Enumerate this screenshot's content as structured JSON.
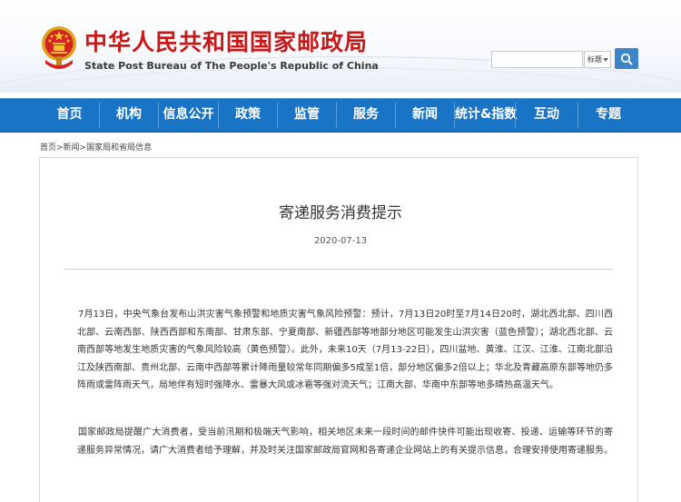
{
  "header": {
    "title_cn": "中华人民共和国国家邮政局",
    "title_en": "State Post Bureau of The People's Republic of China",
    "emblem_icon": "national-emblem-icon",
    "search": {
      "placeholder": "",
      "select_value": "标题",
      "button_icon": "search-icon"
    }
  },
  "nav": {
    "items": [
      {
        "label": "首页"
      },
      {
        "label": "机构"
      },
      {
        "label": "信息公开"
      },
      {
        "label": "政策"
      },
      {
        "label": "监管"
      },
      {
        "label": "服务"
      },
      {
        "label": "新闻"
      },
      {
        "label": "统计&指数"
      },
      {
        "label": "互动"
      },
      {
        "label": "专题"
      }
    ],
    "color": "#1a74c6"
  },
  "breadcrumb": "首页>新闻>国家局和省局信息",
  "article": {
    "title": "寄递服务消费提示",
    "date": "2020-07-13",
    "paragraphs": [
      "7月13日，中央气象台发布山洪灾害气象预警和地质灾害气象风险预警：预计，7月13日20时至7月14日20时，湖北西北部、四川西北部、云南西部、陕西西部和东南部、甘肃东部、宁夏南部、新疆西部等地部分地区可能发生山洪灾害（蓝色预警）；湖北西北部、云南西部等地发生地质灾害的气象风险较高（黄色预警）。此外，未来10天（7月13-22日），四川盆地、黄淮、江汉、江淮、江南北部沿江及陕西南部、贵州北部、云南中西部等累计降雨量较常年同期偏多5成至1倍，部分地区偏多2倍以上；华北及青藏高原东部等地仍多阵雨或雷阵雨天气，局地伴有短时强降水、雷暴大风或冰雹等强对流天气；江南大部、华南中东部等地多晴热高温天气。",
      "国家邮政局提醒广大消费者，受当前汛期和极端天气影响，相关地区未来一段时间的邮件快件可能出现收寄、投递、运输等环节的寄递服务异常情况，请广大消费者给予理解，并及时关注国家邮政局官网和各寄递企业网站上的有关提示信息，合理安排使用寄递服务。"
    ]
  },
  "colors": {
    "brand_red": "#c41a1a",
    "nav_blue": "#1a74c6",
    "search_blue": "#3d85c6"
  }
}
